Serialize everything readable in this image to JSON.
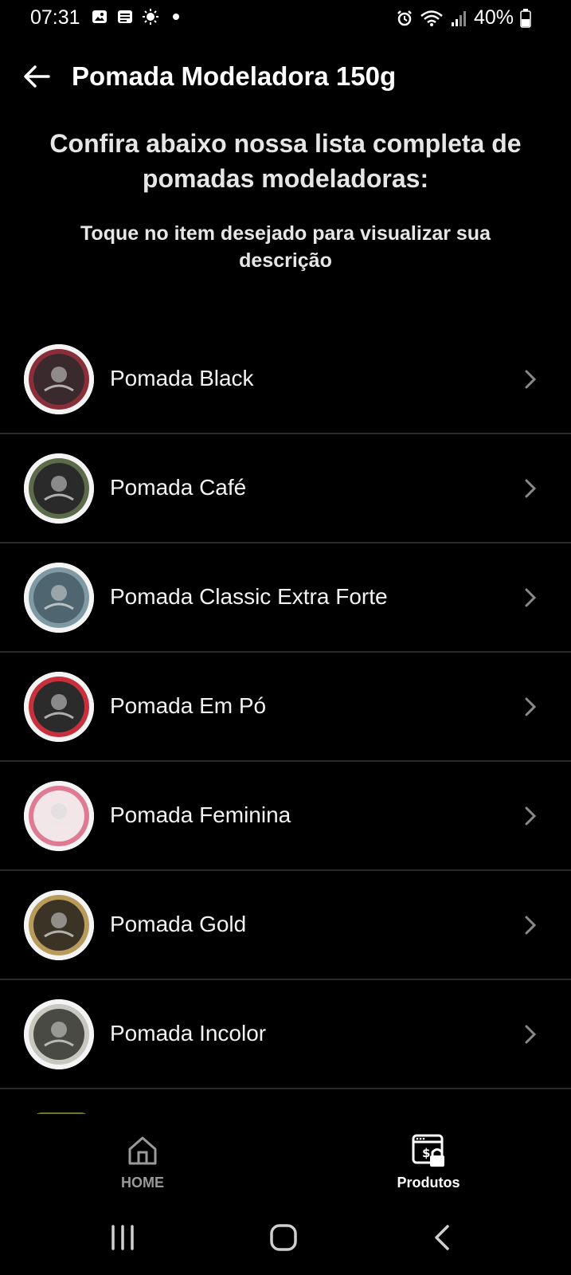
{
  "status_bar": {
    "time": "07:31",
    "battery": "40%",
    "left_icons": [
      "gallery-icon",
      "news-icon",
      "brightness-icon",
      "dot-icon"
    ],
    "right_icons": [
      "alarm-icon",
      "wifi-icon",
      "signal-icon",
      "battery-icon"
    ]
  },
  "app_bar": {
    "title": "Pomada Modeladora 150g",
    "back_icon": "arrow-left-icon"
  },
  "intro": {
    "heading": "Confira abaixo nossa lista completa de pomadas modeladoras:",
    "subtitle": "Toque no item desejado para visualizar sua descrição"
  },
  "products": [
    {
      "label": "Pomada Black",
      "thumb_color": "#3a2a2e",
      "ring_color": "#8a2f3a"
    },
    {
      "label": "Pomada Café",
      "thumb_color": "#2a2a2a",
      "ring_color": "#5c6b4a"
    },
    {
      "label": "Pomada Classic Extra Forte",
      "thumb_color": "#4f6670",
      "ring_color": "#7f9aa3"
    },
    {
      "label": "Pomada Em Pó",
      "thumb_color": "#2b2b2b",
      "ring_color": "#c7303c"
    },
    {
      "label": "Pomada Feminina",
      "thumb_color": "#f2e6e8",
      "ring_color": "#e07a93"
    },
    {
      "label": "Pomada Gold",
      "thumb_color": "#3b3426",
      "ring_color": "#b89b5a"
    },
    {
      "label": "Pomada Incolor",
      "thumb_color": "#4a4a44",
      "ring_color": "#c8c8c0"
    }
  ],
  "bottom_nav": {
    "home_label": "HOME",
    "products_label": "Produtos",
    "home_icon": "home-icon",
    "products_icon": "store-lock-icon",
    "active": "Produtos"
  },
  "system_nav": {
    "recents_icon": "recents-icon",
    "home_icon": "system-home-icon",
    "back_icon": "system-back-icon"
  },
  "colors": {
    "background": "#000000",
    "divider": "#2a2a2a",
    "text": "#f2f2f2",
    "inactive_nav": "#9a9a9a"
  }
}
